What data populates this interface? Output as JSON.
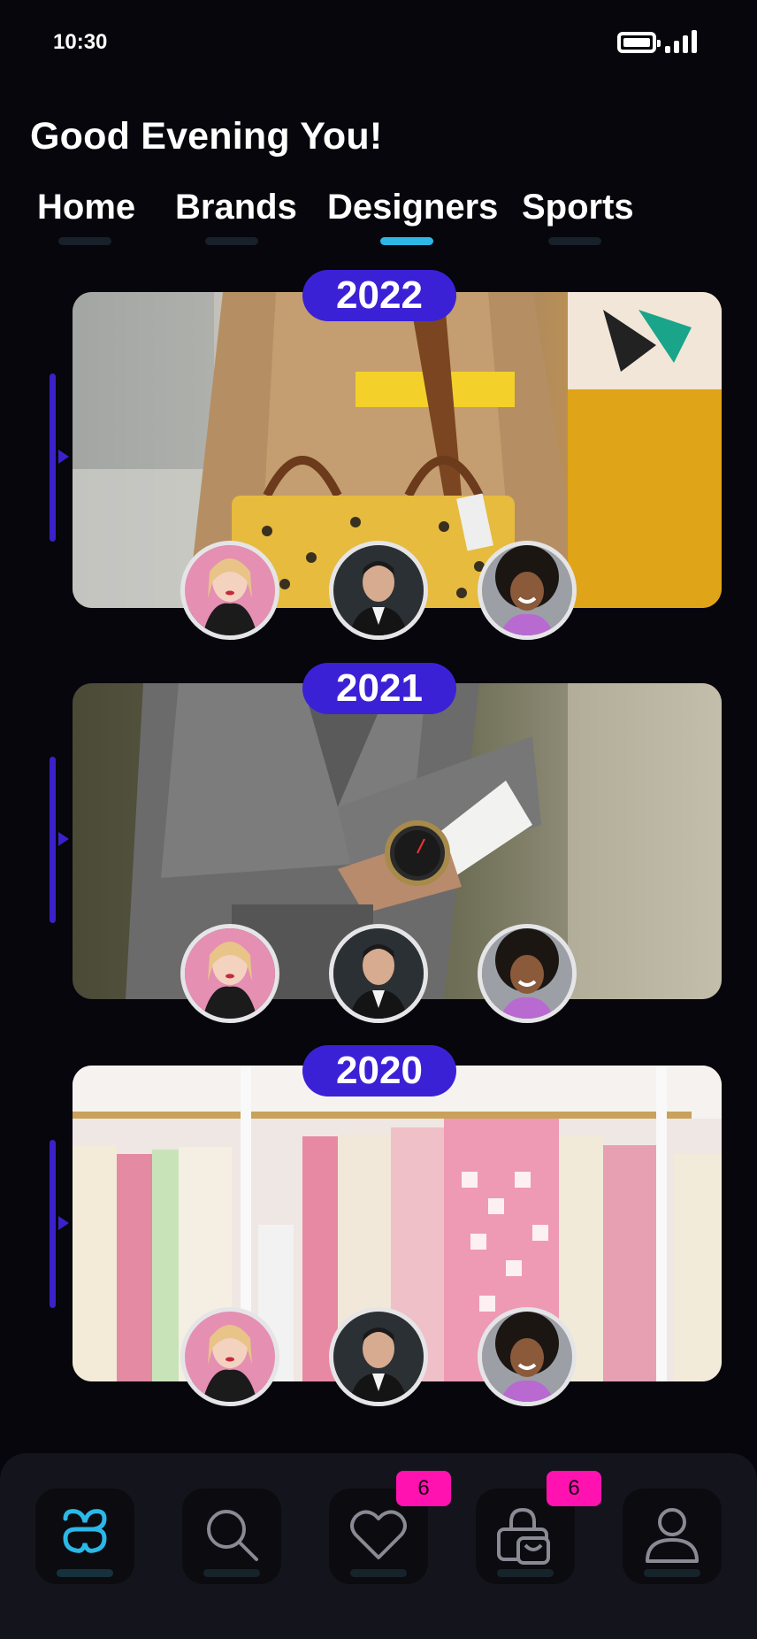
{
  "status_bar": {
    "time": "10:30"
  },
  "greeting": "Good Evening You!",
  "tabs": [
    {
      "label": "Home",
      "active": false
    },
    {
      "label": "Brands",
      "active": false
    },
    {
      "label": "Designers",
      "active": true
    },
    {
      "label": "Sports",
      "active": false
    }
  ],
  "cards": [
    {
      "year": "2022",
      "image": "woman-with-yellow-handbag"
    },
    {
      "year": "2021",
      "image": "man-in-grey-suit-with-watch"
    },
    {
      "year": "2020",
      "image": "clothing-rack-pink-cream"
    }
  ],
  "designers": [
    "designer-blonde-woman",
    "designer-dark-haired-man",
    "designer-curly-haired-girl"
  ],
  "bottom_nav": {
    "items": [
      {
        "icon": "logo-icon",
        "active": true
      },
      {
        "icon": "search-icon",
        "active": false
      },
      {
        "icon": "heart-icon",
        "active": false,
        "badge": "6"
      },
      {
        "icon": "shopping-bag-icon",
        "active": false,
        "badge": "6"
      },
      {
        "icon": "profile-icon",
        "active": false
      }
    ]
  },
  "colors": {
    "background": "#06060c",
    "accent_purple": "#3b21d6",
    "accent_cyan": "#2eb7e6",
    "badge_pink": "#ff12b0",
    "nav_background": "#14141c"
  }
}
